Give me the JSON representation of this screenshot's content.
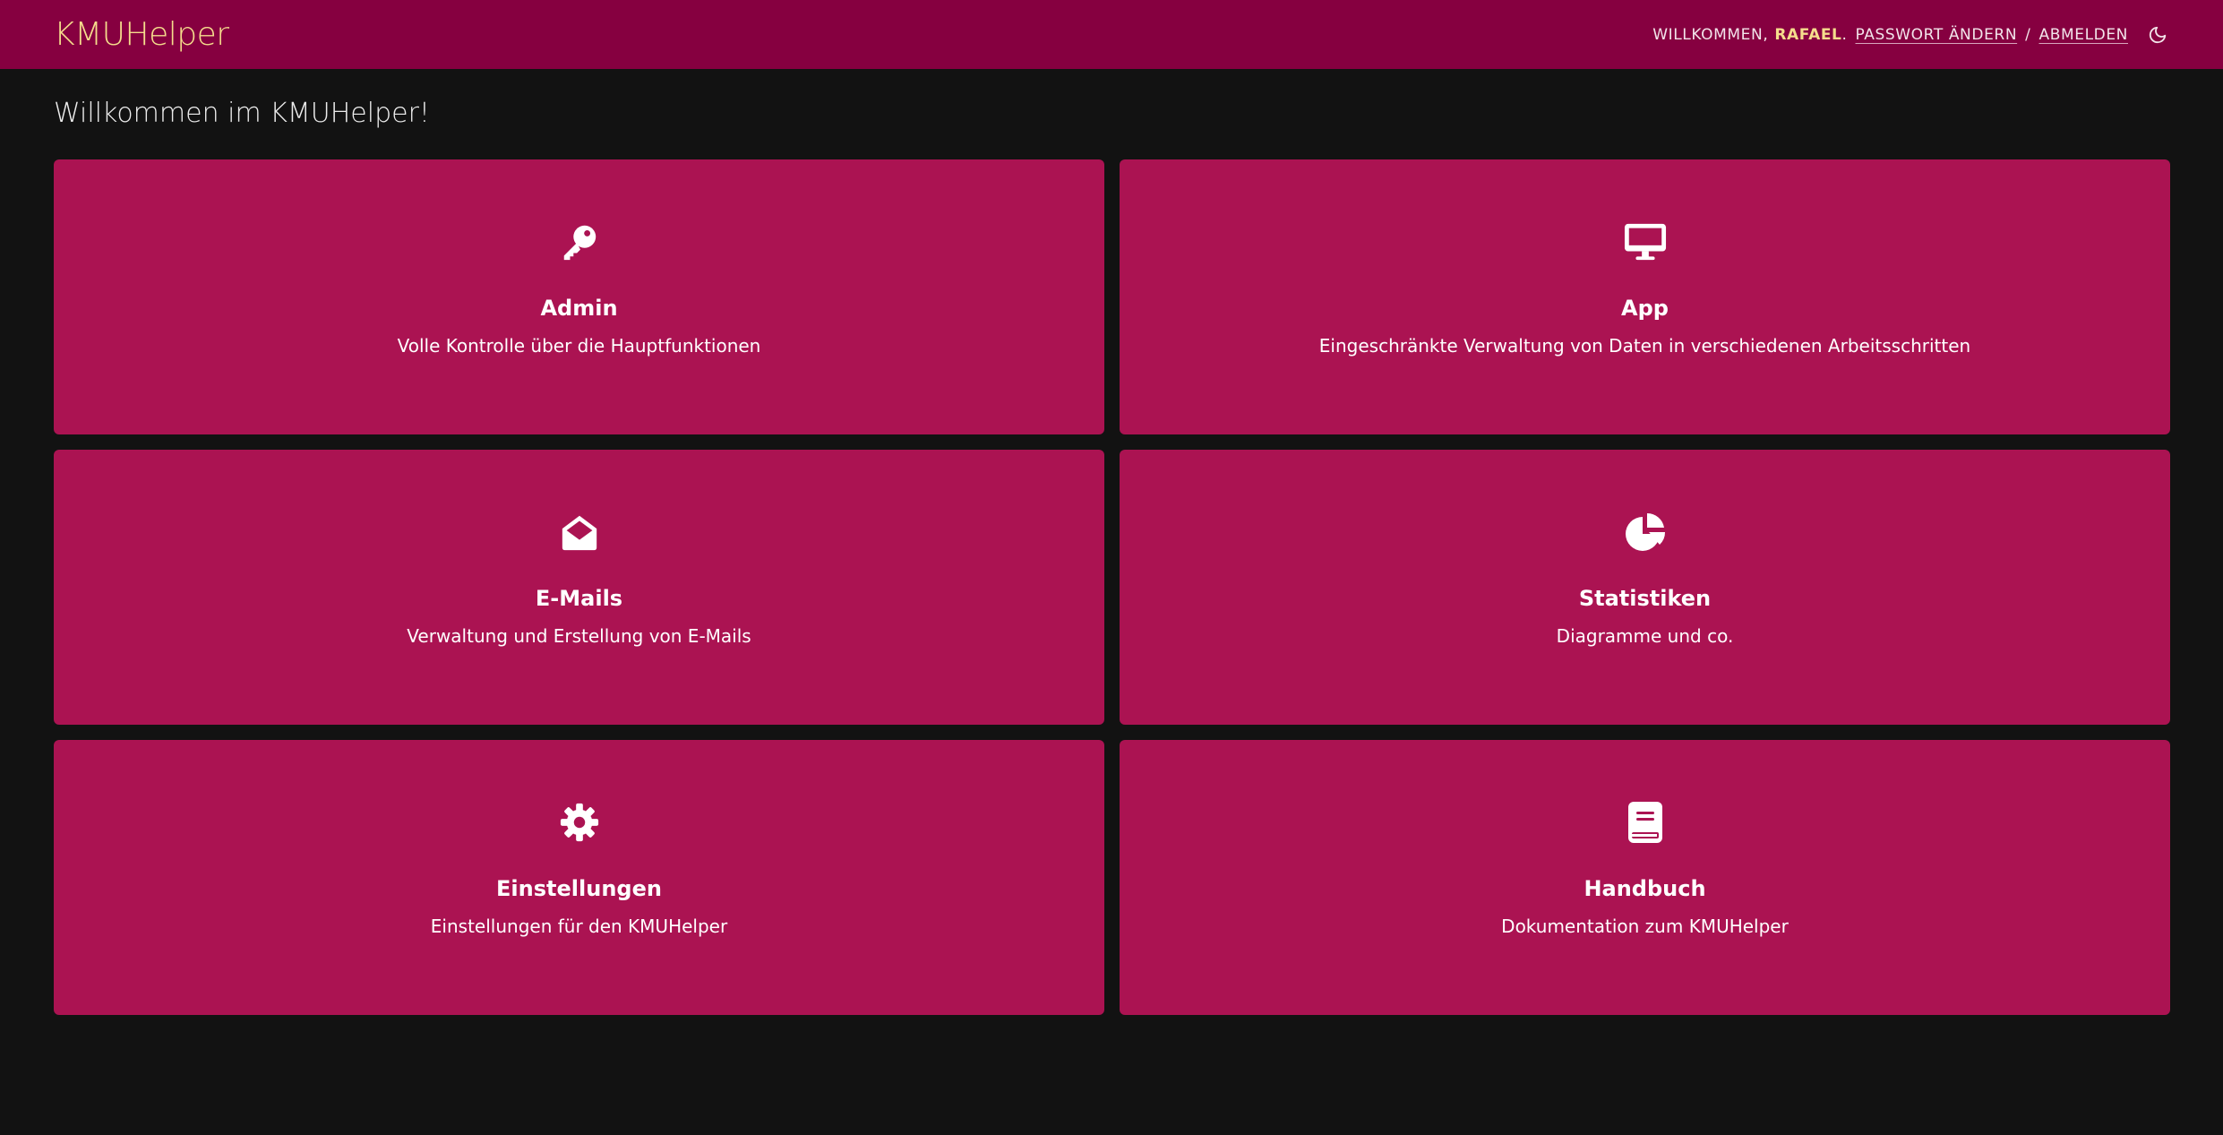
{
  "header": {
    "brand": "KMUHelper",
    "welcome": "Willkommen,",
    "username": "Rafael",
    "change_password": "Passwort ändern",
    "separator": "/",
    "logout": "Abmelden",
    "theme_icon": "moon-icon"
  },
  "main": {
    "title": "Willkommen im KMUHelper!",
    "cards": [
      {
        "icon": "key-icon",
        "title": "Admin",
        "description": "Volle Kontrolle über die Hauptfunktionen"
      },
      {
        "icon": "desktop-icon",
        "title": "App",
        "description": "Eingeschränkte Verwaltung von Daten in verschiedenen Arbeitsschritten"
      },
      {
        "icon": "envelope-open-icon",
        "title": "E-Mails",
        "description": "Verwaltung und Erstellung von E-Mails"
      },
      {
        "icon": "pie-chart-icon",
        "title": "Statistiken",
        "description": "Diagramme und co."
      },
      {
        "icon": "gear-icon",
        "title": "Einstellungen",
        "description": "Einstellungen für den KMUHelper"
      },
      {
        "icon": "book-icon",
        "title": "Handbuch",
        "description": "Dokumentation zum KMUHelper"
      }
    ]
  },
  "colors": {
    "header_bg": "#860040",
    "brand": "#f5dd8c",
    "page_bg": "#121212",
    "card_bg": "#ab1352"
  }
}
